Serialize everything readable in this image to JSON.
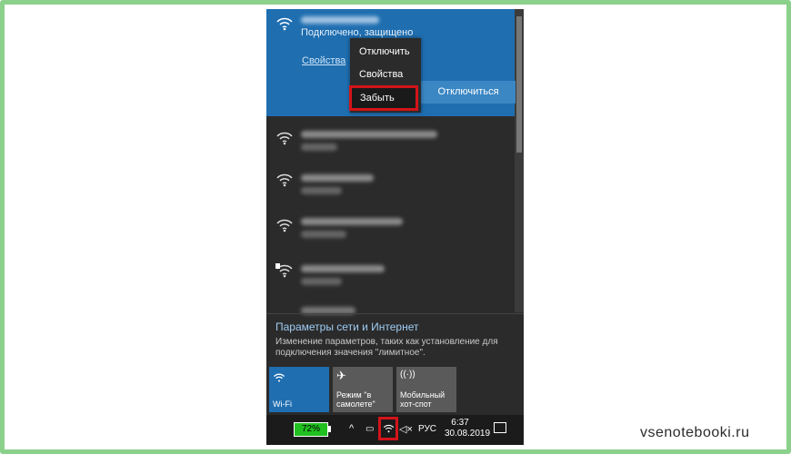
{
  "connected_network": {
    "status": "Подключено, защищено",
    "properties_link": "Свойства"
  },
  "context_menu": {
    "items": [
      "Отключить",
      "Свойства",
      "Забыть"
    ]
  },
  "disconnect_button": "Отключиться",
  "settings": {
    "title": "Параметры сети и Интернет",
    "description": "Изменение параметров, таких как установление для подключения значения \"лимитное\"."
  },
  "quick_actions": {
    "wifi": "Wi-Fi",
    "airplane": "Режим \"в самолете\"",
    "hotspot": "Мобильный хот-спот"
  },
  "taskbar": {
    "battery": "72%",
    "language": "РУС",
    "time": "6:37",
    "date": "30.08.2019"
  },
  "watermark": "vsenotebooki.ru",
  "colors": {
    "accent": "#1f6eb0",
    "highlight": "#d3141a",
    "battery": "#20c020"
  }
}
